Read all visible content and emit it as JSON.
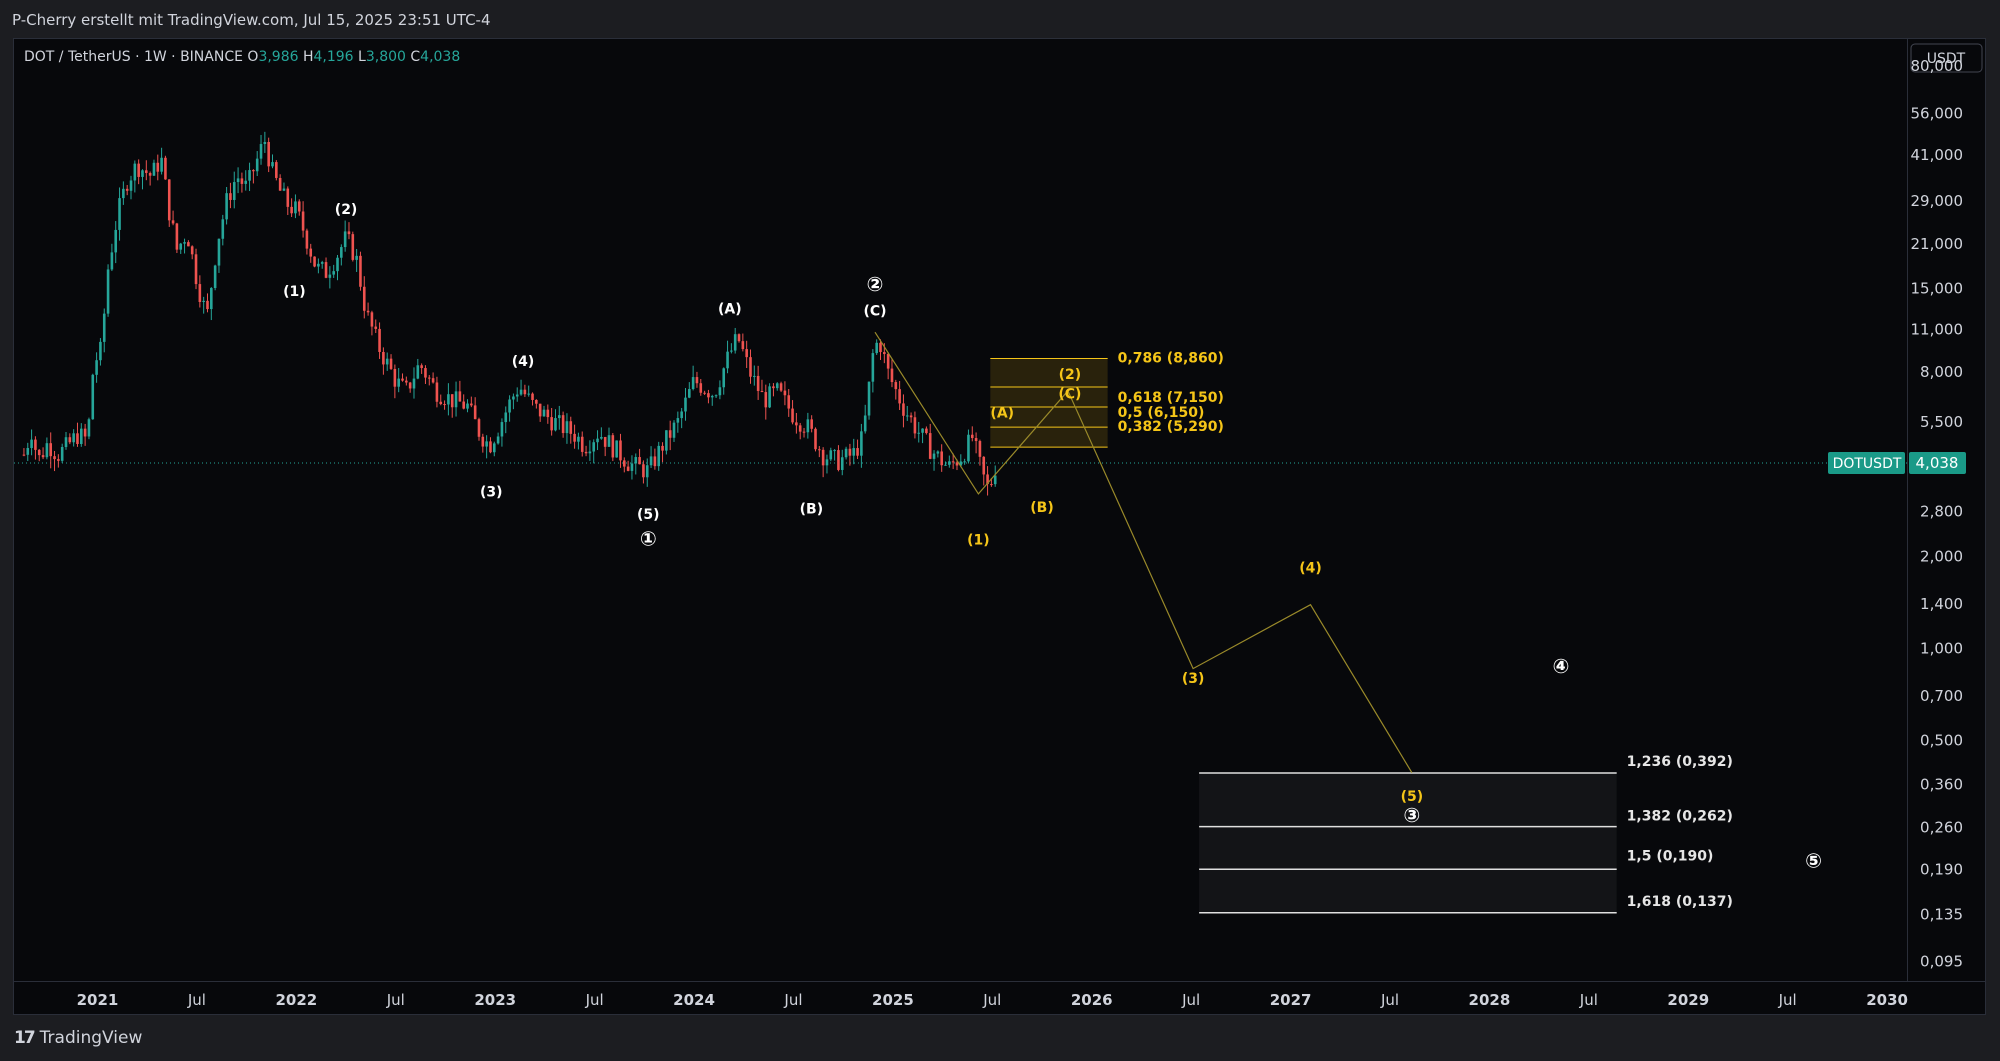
{
  "header": {
    "credit": "P-Cherry erstellt mit TradingView.com, Jul 15, 2025 23:51 UTC-4"
  },
  "footer": {
    "brand": "TradingView",
    "logo_icon": "tradingview-logo-icon"
  },
  "chart_data": {
    "type": "candlestick",
    "symbol_line": "DOT / TetherUS · 1W · BINANCE",
    "ohlc": {
      "O": "3,986",
      "H": "4,196",
      "L": "3,800",
      "C": "4,038"
    },
    "currency": "USDT",
    "scale": "log",
    "y_ticks": [
      "80,000",
      "56,000",
      "41,000",
      "29,000",
      "21,000",
      "15,000",
      "11,000",
      "8,000",
      "5,500",
      "4,000",
      "2,800",
      "2,000",
      "1,400",
      "1,000",
      "0,700",
      "0,500",
      "0,360",
      "0,260",
      "0,190",
      "0,135",
      "0,095"
    ],
    "y_tick_values": [
      80,
      56,
      41,
      29,
      21,
      15,
      11,
      8,
      5.5,
      4,
      2.8,
      2,
      1.4,
      1,
      0.7,
      0.5,
      0.36,
      0.26,
      0.19,
      0.135,
      0.095
    ],
    "x_ticks": [
      "2021",
      "Jul",
      "2022",
      "Jul",
      "2023",
      "Jul",
      "2024",
      "Jul",
      "2025",
      "Jul",
      "2026",
      "Jul",
      "2027",
      "Jul",
      "2028",
      "Jul",
      "2029",
      "Jul",
      "2030"
    ],
    "x_tick_years": [
      2021,
      2021.5,
      2022,
      2022.5,
      2023,
      2023.5,
      2024,
      2024.5,
      2025,
      2025.5,
      2026,
      2026.5,
      2027,
      2027.5,
      2028,
      2028.5,
      2029,
      2029.5,
      2030
    ],
    "x_range": [
      2020.58,
      2030.1
    ],
    "y_range": [
      0.082,
      98
    ],
    "last_price": {
      "label": "DOTUSDT",
      "value": "4,038",
      "price": 4.038
    },
    "colors": {
      "up": "#26a69a",
      "down": "#ef5350",
      "wave": "#f5c518",
      "fib_fill": "#f5c518",
      "fib_white": "#ffffff"
    },
    "price_path": [
      [
        2020.63,
        4.3
      ],
      [
        2020.67,
        5.2
      ],
      [
        2020.7,
        4.1
      ],
      [
        2020.75,
        4.7
      ],
      [
        2020.8,
        4.3
      ],
      [
        2020.85,
        4.6
      ],
      [
        2020.9,
        5.0
      ],
      [
        2020.95,
        4.8
      ],
      [
        2020.98,
        8.5
      ],
      [
        2021.02,
        9.5
      ],
      [
        2021.05,
        17
      ],
      [
        2021.1,
        26
      ],
      [
        2021.15,
        34
      ],
      [
        2021.2,
        38
      ],
      [
        2021.27,
        35
      ],
      [
        2021.32,
        40
      ],
      [
        2021.36,
        27
      ],
      [
        2021.4,
        20
      ],
      [
        2021.45,
        23
      ],
      [
        2021.5,
        16
      ],
      [
        2021.55,
        12
      ],
      [
        2021.6,
        21
      ],
      [
        2021.65,
        29
      ],
      [
        2021.7,
        35
      ],
      [
        2021.75,
        32
      ],
      [
        2021.8,
        39
      ],
      [
        2021.84,
        46
      ],
      [
        2021.88,
        36
      ],
      [
        2021.92,
        31
      ],
      [
        2021.96,
        28
      ],
      [
        2022.0,
        27
      ],
      [
        2022.05,
        22
      ],
      [
        2022.1,
        17.5
      ],
      [
        2022.15,
        17
      ],
      [
        2022.2,
        19
      ],
      [
        2022.25,
        22
      ],
      [
        2022.3,
        19
      ],
      [
        2022.35,
        12.5
      ],
      [
        2022.42,
        9.5
      ],
      [
        2022.5,
        7.5
      ],
      [
        2022.55,
        6.9
      ],
      [
        2022.62,
        8.5
      ],
      [
        2022.7,
        7.0
      ],
      [
        2022.78,
        6.5
      ],
      [
        2022.86,
        6.2
      ],
      [
        2022.92,
        5.1
      ],
      [
        2022.97,
        4.6
      ],
      [
        2023.03,
        5.5
      ],
      [
        2023.08,
        6.5
      ],
      [
        2023.12,
        7.2
      ],
      [
        2023.2,
        6.1
      ],
      [
        2023.3,
        5.5
      ],
      [
        2023.4,
        5.0
      ],
      [
        2023.45,
        4.6
      ],
      [
        2023.52,
        5.1
      ],
      [
        2023.6,
        4.5
      ],
      [
        2023.68,
        4.0
      ],
      [
        2023.77,
        3.8
      ],
      [
        2023.84,
        4.6
      ],
      [
        2023.92,
        5.5
      ],
      [
        2024.0,
        7.5
      ],
      [
        2024.1,
        6.8
      ],
      [
        2024.17,
        8.9
      ],
      [
        2024.22,
        10.4
      ],
      [
        2024.28,
        8.0
      ],
      [
        2024.35,
        6.5
      ],
      [
        2024.42,
        6.9
      ],
      [
        2024.5,
        5.8
      ],
      [
        2024.57,
        5.3
      ],
      [
        2024.65,
        4.3
      ],
      [
        2024.72,
        4.1
      ],
      [
        2024.8,
        4.3
      ],
      [
        2024.85,
        4.9
      ],
      [
        2024.9,
        9.2
      ],
      [
        2024.93,
        10.3
      ],
      [
        2024.98,
        7.8
      ],
      [
        2025.05,
        6.2
      ],
      [
        2025.12,
        5.2
      ],
      [
        2025.2,
        4.4
      ],
      [
        2025.28,
        3.9
      ],
      [
        2025.35,
        4.3
      ],
      [
        2025.4,
        4.9
      ],
      [
        2025.45,
        3.7
      ],
      [
        2025.48,
        3.3
      ],
      [
        2025.5,
        3.6
      ],
      [
        2025.52,
        4.05
      ]
    ],
    "wave_labels": [
      {
        "text": "(1)",
        "x": 2021.99,
        "y": 14.7,
        "color": "white"
      },
      {
        "text": "(2)",
        "x": 2022.25,
        "y": 27.3,
        "color": "white"
      },
      {
        "text": "(3)",
        "x": 2022.98,
        "y": 3.26,
        "color": "white"
      },
      {
        "text": "(4)",
        "x": 2023.14,
        "y": 8.7,
        "color": "white"
      },
      {
        "text": "(5)",
        "x": 2023.77,
        "y": 2.75,
        "color": "white"
      },
      {
        "text": "①",
        "x": 2023.77,
        "y": 2.25,
        "color": "white"
      },
      {
        "text": "(A)",
        "x": 2024.18,
        "y": 12.9,
        "color": "white"
      },
      {
        "text": "(B)",
        "x": 2024.59,
        "y": 2.87,
        "color": "white"
      },
      {
        "text": "②",
        "x": 2024.91,
        "y": 15.3,
        "color": "white"
      },
      {
        "text": "(C)",
        "x": 2024.91,
        "y": 12.7,
        "color": "white"
      },
      {
        "text": "(1)",
        "x": 2025.43,
        "y": 2.27,
        "color": "yellow"
      },
      {
        "text": "(A)",
        "x": 2025.55,
        "y": 5.9,
        "color": "yellow"
      },
      {
        "text": "(B)",
        "x": 2025.75,
        "y": 2.9,
        "color": "yellow"
      },
      {
        "text": "(2)",
        "x": 2025.89,
        "y": 7.9,
        "color": "yellow"
      },
      {
        "text": "(C)",
        "x": 2025.89,
        "y": 6.8,
        "color": "yellow"
      },
      {
        "text": "(3)",
        "x": 2026.51,
        "y": 0.8,
        "color": "yellow"
      },
      {
        "text": "(4)",
        "x": 2027.1,
        "y": 1.84,
        "color": "yellow"
      },
      {
        "text": "(5)",
        "x": 2027.61,
        "y": 0.33,
        "color": "yellow"
      },
      {
        "text": "③",
        "x": 2027.61,
        "y": 0.282,
        "color": "white"
      },
      {
        "text": "④",
        "x": 2028.36,
        "y": 0.865,
        "color": "white"
      },
      {
        "text": "⑤",
        "x": 2029.63,
        "y": 0.2,
        "color": "white"
      }
    ],
    "projection_path": [
      [
        2024.91,
        10.8
      ],
      [
        2025.43,
        3.2
      ],
      [
        2025.88,
        6.95
      ],
      [
        2026.51,
        0.86
      ],
      [
        2027.1,
        1.39
      ],
      [
        2027.61,
        0.393
      ]
    ],
    "fib_retracement": {
      "x_start": 2025.49,
      "x_end": 2026.08,
      "levels": [
        {
          "label": "0,786 (8,860)",
          "price": 8.86
        },
        {
          "label": "0,618 (7,150)",
          "price": 7.15
        },
        {
          "label": "0,5 (6,150)",
          "price": 6.15
        },
        {
          "label": "0,382 (5,290)",
          "price": 5.29
        }
      ],
      "extra_line": 4.55
    },
    "fib_extension": {
      "x_start": 2026.54,
      "x_end": 2028.64,
      "levels": [
        {
          "label": "1,236 (0,392)",
          "price": 0.392
        },
        {
          "label": "1,382 (0,262)",
          "price": 0.262
        },
        {
          "label": "1,5 (0,190)",
          "price": 0.19
        },
        {
          "label": "1,618 (0,137)",
          "price": 0.137
        }
      ]
    }
  }
}
